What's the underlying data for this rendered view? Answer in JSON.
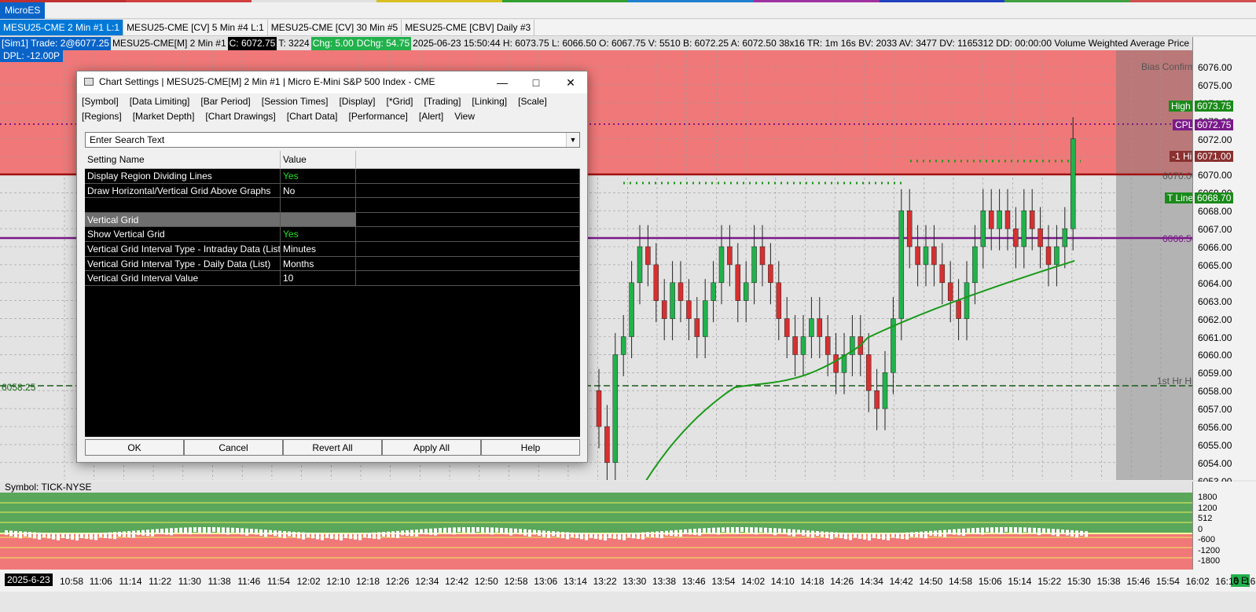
{
  "app": {
    "title": "MicroES",
    "accent_strip": [
      "#c03030",
      "#d04040",
      "#e0e0e0",
      "#d8c020",
      "#30a030",
      "#2080d0",
      "#a030a0",
      "#2040c0",
      "#40a040",
      "#d05050"
    ]
  },
  "tabs": [
    {
      "label": "MESU25-CME  2 Min  #1 L:1",
      "active": true
    },
    {
      "label": "MESU25-CME [CV]  5 Min  #4 L:1",
      "active": false
    },
    {
      "label": "MESU25-CME [CV]  30 Min  #5",
      "active": false
    },
    {
      "label": "MESU25-CME [CBV]  Daily #3",
      "active": false
    }
  ],
  "infobar": {
    "sim": "[Sim1]  Trade: 2@6077.25",
    "symbol": "MESU25-CME[M]  2 Min  #1",
    "close": "C: 6072.75",
    "ticks": "T: 3224",
    "chg": "Chg: 5.00",
    "dchg": "DChg: 54.75",
    "rest": "2025-06-23 15:50:44 H: 6073.75 L: 6066.50 O: 6067.75 V: 5510 B: 6072.25 A: 6072.50 38x16 TR: 1m 16s BV: 2033 AV: 3477 DV: 1165312 DD: 00:00:00 Volume Weighted Average Price - Rolling  Time Line"
  },
  "dpl": "DPL: -12.00P",
  "price_axis": {
    "labels": [
      "6076.00",
      "6075.00",
      "6074.00",
      "6073.00",
      "6072.00",
      "6071.00",
      "6070.00",
      "6069.00",
      "6068.00",
      "6067.00",
      "6066.00",
      "6065.00",
      "6064.00",
      "6063.00",
      "6062.00",
      "6061.00",
      "6060.00",
      "6059.00",
      "6058.00",
      "6057.00",
      "6056.00",
      "6055.00",
      "6054.00",
      "6053.00"
    ],
    "tags": [
      {
        "text": "6073.75",
        "color": "#1a8a1a"
      },
      {
        "text": "6072.75",
        "color": "#7a1a8a"
      },
      {
        "text": "6071.00",
        "color": "#8a3030"
      },
      {
        "text": "6068.70",
        "color": "#1a8a1a"
      }
    ]
  },
  "plot_labels": {
    "bias_confirm": "Bias Confirm",
    "high": "High",
    "cpl": "CPL",
    "one_hi": "-1 Hi",
    "level_6070": "6070.00",
    "t_line": "T Line",
    "level_6066": "6066.50",
    "first_hr_hi": "1st Hr Hi",
    "left_6058": "6058.25"
  },
  "subgraph": {
    "title": "Symbol: TICK-NYSE",
    "axis": [
      "1800",
      "1200",
      "512",
      "0",
      "-600",
      "-1200",
      "-1800"
    ]
  },
  "time_axis": {
    "date": "2025-6-23",
    "labels": [
      "10:58",
      "11:06",
      "11:14",
      "11:22",
      "11:30",
      "11:38",
      "11:46",
      "11:54",
      "12:02",
      "12:10",
      "12:18",
      "12:26",
      "12:34",
      "12:42",
      "12:50",
      "12:58",
      "13:06",
      "13:14",
      "13:22",
      "13:30",
      "13:38",
      "13:46",
      "13:54",
      "14:02",
      "14:10",
      "14:18",
      "14:26",
      "14:34",
      "14:42",
      "14:50",
      "14:58",
      "15:06",
      "15:14",
      "15:22",
      "15:30",
      "15:38",
      "15:46",
      "15:54",
      "16:02",
      "16:10",
      "16:18"
    ],
    "corner": "8 E"
  },
  "dialog": {
    "title": "Chart Settings | MESU25-CME[M]  2 Min  #1 | Micro E-Mini S&P 500 Index - CME",
    "menu_row1": [
      "[Symbol]",
      "[Data Limiting]",
      "[Bar Period]",
      "[Session Times]",
      "[Display]",
      "[*Grid]",
      "[Trading]",
      "[Linking]",
      "[Scale]"
    ],
    "menu_row2": [
      "[Regions]",
      "[Market Depth]",
      "[Chart Drawings]",
      "[Chart Data]",
      "[Performance]",
      "[Alert]",
      "View"
    ],
    "search_placeholder": "Enter Search Text",
    "col_setting": "Setting Name",
    "col_value": "Value",
    "rows": [
      {
        "name": "Display Region Dividing Lines",
        "value": "Yes",
        "green": true
      },
      {
        "name": "Draw Horizontal/Vertical Grid Above Graphs",
        "value": "No",
        "green": false
      },
      {
        "name": "",
        "value": "",
        "green": false
      },
      {
        "name": "Vertical Grid",
        "value": "",
        "section": true
      },
      {
        "name": "Show Vertical Grid",
        "value": "Yes",
        "green": true
      },
      {
        "name": "Vertical Grid Interval Type - Intraday Data (List)",
        "value": "Minutes",
        "green": false
      },
      {
        "name": "Vertical Grid Interval Type - Daily Data (List)",
        "value": "Months",
        "green": false
      },
      {
        "name": "Vertical Grid Interval Value",
        "value": "10",
        "green": false
      }
    ],
    "buttons": {
      "ok": "OK",
      "cancel": "Cancel",
      "revert": "Revert All",
      "apply": "Apply All",
      "help": "Help"
    }
  }
}
